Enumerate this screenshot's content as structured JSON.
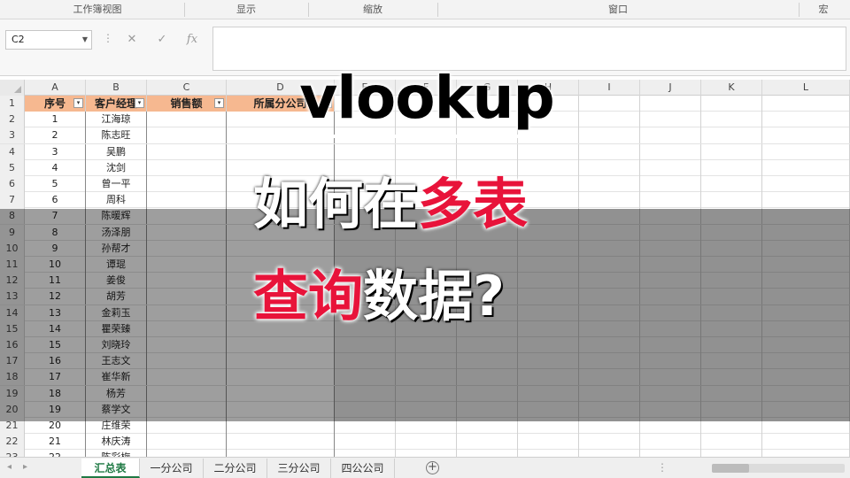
{
  "ribbon": {
    "groups": [
      {
        "label": "工作簿视图"
      },
      {
        "label": "显示"
      },
      {
        "label": "缩放"
      },
      {
        "label": "窗口"
      },
      {
        "label": "宏"
      }
    ]
  },
  "formula_bar": {
    "name_box": "C2",
    "dots": "⋮",
    "cancel_glyph": "✕",
    "enter_glyph": "✓",
    "fx_glyph": "fx",
    "formula_value": ""
  },
  "columns": [
    "A",
    "B",
    "C",
    "D",
    "E",
    "F",
    "G",
    "H",
    "I",
    "J",
    "K",
    "L"
  ],
  "table": {
    "headers": [
      "序号",
      "客户经理",
      "销售额",
      "所属分公司"
    ],
    "rows": [
      [
        "1",
        "江海琼"
      ],
      [
        "2",
        "陈志旺"
      ],
      [
        "3",
        "吴鹏"
      ],
      [
        "4",
        "沈剑"
      ],
      [
        "5",
        "曾一平"
      ],
      [
        "6",
        "周科"
      ],
      [
        "7",
        "陈暖辉"
      ],
      [
        "8",
        "汤泽朋"
      ],
      [
        "9",
        "孙帮才"
      ],
      [
        "10",
        "谭琨"
      ],
      [
        "11",
        "姜俊"
      ],
      [
        "12",
        "胡芳"
      ],
      [
        "13",
        "金莉玉"
      ],
      [
        "14",
        "瞿荣臻"
      ],
      [
        "15",
        "刘晓玲"
      ],
      [
        "16",
        "王志文"
      ],
      [
        "17",
        "崔华新"
      ],
      [
        "18",
        "杨芳"
      ],
      [
        "19",
        "蔡学文"
      ],
      [
        "20",
        "庄维荣"
      ],
      [
        "21",
        "林庆涛"
      ],
      [
        "22",
        "陈彩梅"
      ]
    ]
  },
  "overlay": {
    "title": "vlookup",
    "line2_white": "如何在",
    "line2_red": "多表",
    "line3_red": "查询",
    "line3_white": "数据?",
    "accent_red": "#e8133a"
  },
  "sheet_tabs": [
    {
      "label": "汇总表",
      "active": true
    },
    {
      "label": "一分公司",
      "active": false
    },
    {
      "label": "二分公司",
      "active": false
    },
    {
      "label": "三分公司",
      "active": false
    },
    {
      "label": "四公公司",
      "active": false
    }
  ],
  "tab_bar": {
    "add_glyph": "+",
    "nav_prev": "◂",
    "nav_next": "▸",
    "dots": "⋮"
  },
  "colors": {
    "header_fill": "#f6b890",
    "active_tab": "#1f7a44"
  }
}
